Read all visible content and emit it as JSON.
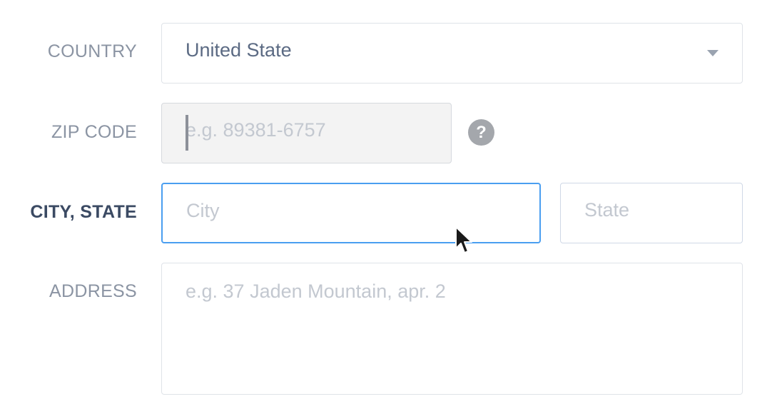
{
  "form": {
    "country": {
      "label": "COUNTRY",
      "value": "United State"
    },
    "zip": {
      "label": "ZIP CODE",
      "placeholder": "e.g. 89381-6757",
      "help_icon": "question-mark-icon",
      "help_glyph": "?"
    },
    "city_state": {
      "label": "CITY, STATE",
      "city_placeholder": "City",
      "state_placeholder": "State"
    },
    "address": {
      "label": "ADDRESS",
      "placeholder": "e.g. 37 Jaden Mountain, apr. 2"
    }
  },
  "colors": {
    "focus_border": "#4a9ef0",
    "label": "#8b94a3",
    "label_active": "#3b4a63",
    "placeholder": "#c3c8d0",
    "disabled_bg": "#f3f3f3"
  },
  "icons": {
    "dropdown": "chevron-down-icon",
    "cursor": "mouse-pointer-icon"
  }
}
